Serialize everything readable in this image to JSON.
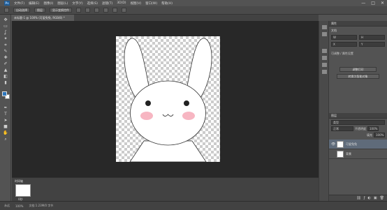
{
  "app": {
    "logo": "Ps"
  },
  "menu": {
    "items": [
      "文件(F)",
      "编辑(E)",
      "图像(I)",
      "图层(L)",
      "文字(Y)",
      "选择(S)",
      "滤镜(T)",
      "3D(D)",
      "视图(V)",
      "窗口(W)",
      "帮助(H)"
    ]
  },
  "window_controls": {
    "minimize": "—",
    "maximize": "□",
    "close": "✕"
  },
  "options_bar": {
    "auto_select": "自动选择",
    "target": "图层",
    "transform": "显示变换控件"
  },
  "document": {
    "tab_title": "未标题-1 @ 100% (可爱兔兔, RGB/8) *"
  },
  "properties": {
    "header": "属性",
    "doc_title": "文档",
    "w_label": "W",
    "h_label": "H",
    "x_label": "X",
    "y_label": "Y",
    "adjust": "可调整 / 属性设置",
    "btn1": "调整打印",
    "btn2": "转换为智能对象"
  },
  "layers": {
    "header": "图层",
    "kind": "类型",
    "blend": "正常",
    "opacity_label": "不透明度",
    "opacity": "100%",
    "fill_label": "填充",
    "fill": "100%",
    "items": [
      {
        "name": "可爱兔兔",
        "eye": "👁"
      },
      {
        "name": "背景",
        "eye": ""
      }
    ]
  },
  "timeline": {
    "label": "时间轴",
    "frame_delay": "0秒"
  },
  "status": {
    "zoom": "100%",
    "info": "文档:1.23M/0 字节",
    "loop": "永远"
  },
  "colors": {
    "foreground": "#2d76bd",
    "background": "#ffffff",
    "accent_layer": "#5f6b7a"
  },
  "artwork": {
    "subject": "bunny"
  }
}
